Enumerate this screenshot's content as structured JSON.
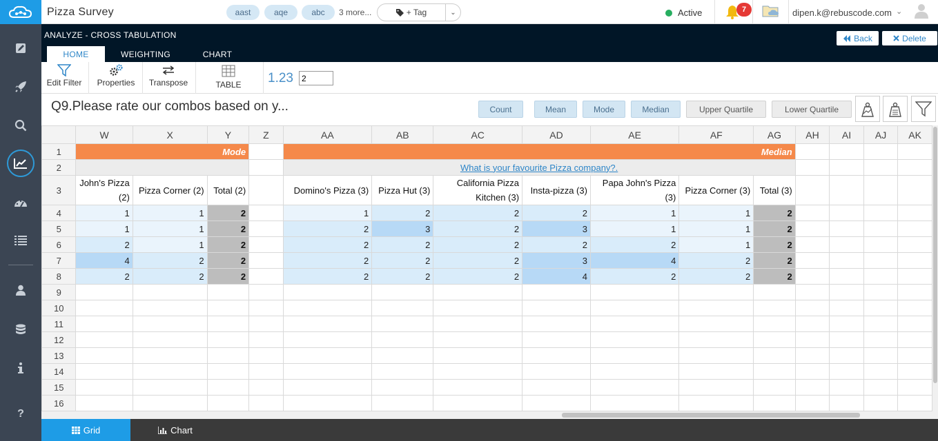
{
  "app": {
    "title": "Pizza Survey"
  },
  "tags": [
    "aast",
    "aqe",
    "abc"
  ],
  "more_tags": "3 more...",
  "tag_button": "+ Tag",
  "status": "Active",
  "notifications": "7",
  "user_email": "dipen.k@rebuscode.com",
  "header": {
    "title": "ANALYZE - CROSS TABULATION",
    "tabs": [
      "HOME",
      "WEIGHTING",
      "CHART"
    ],
    "back": "Back",
    "delete": "Delete"
  },
  "toolbar": {
    "edit_filter": "Edit Filter",
    "properties": "Properties",
    "transpose": "Transpose",
    "table": "TABLE",
    "decimal_label": "1.23",
    "decimal_value": "2"
  },
  "question": "Q9.Please rate our combos based on y...",
  "stats_buttons": [
    "Count",
    "Mean",
    "Mode",
    "Median",
    "Upper Quartile",
    "Lower Quartile"
  ],
  "grid": {
    "columns": [
      "W",
      "X",
      "Y",
      "Z",
      "AA",
      "AB",
      "AC",
      "AD",
      "AE",
      "AF",
      "AG",
      "AH",
      "AI",
      "AJ",
      "AK"
    ],
    "rows": [
      "1",
      "2",
      "3",
      "4",
      "5",
      "6",
      "7",
      "8",
      "9",
      "10",
      "11",
      "12",
      "13",
      "14",
      "15",
      "16"
    ],
    "mode_label": "Mode",
    "median_label": "Median",
    "median_question": "What is your favourite Pizza company?.",
    "mode_headers": [
      "John's Pizza (2)",
      "Pizza Corner (2)",
      "Total (2)"
    ],
    "median_headers": [
      "Domino's Pizza (3)",
      "Pizza Hut (3)",
      "California Pizza Kitchen (3)",
      "Insta-pizza (3)",
      "Papa John's Pizza (3)",
      "Pizza Corner (3)",
      "Total (3)"
    ],
    "mode_values": [
      [
        "1",
        "1",
        "2"
      ],
      [
        "1",
        "1",
        "2"
      ],
      [
        "2",
        "1",
        "2"
      ],
      [
        "4",
        "2",
        "2"
      ],
      [
        "2",
        "2",
        "2"
      ]
    ],
    "median_values": [
      [
        "1",
        "2",
        "2",
        "2",
        "1",
        "1",
        "2"
      ],
      [
        "2",
        "3",
        "2",
        "3",
        "1",
        "1",
        "2"
      ],
      [
        "2",
        "2",
        "2",
        "2",
        "2",
        "1",
        "2"
      ],
      [
        "2",
        "2",
        "2",
        "3",
        "4",
        "2",
        "2"
      ],
      [
        "2",
        "2",
        "2",
        "4",
        "2",
        "2",
        "2"
      ]
    ]
  },
  "bottom_tabs": [
    "Grid",
    "Chart"
  ]
}
